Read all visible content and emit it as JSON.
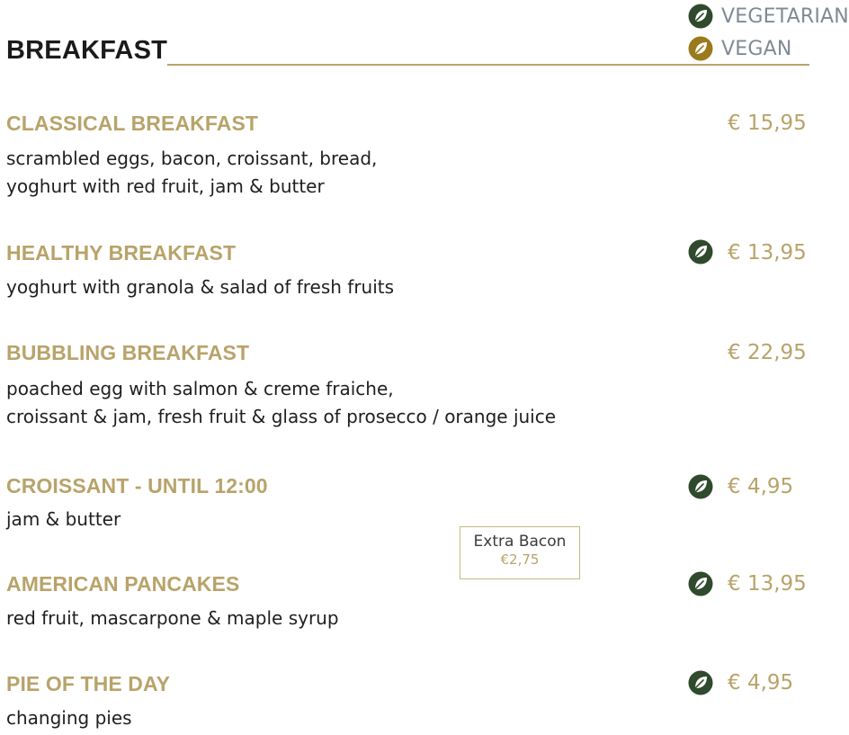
{
  "section_title": "BREAKFAST",
  "legend": [
    {
      "label": "VEGETARIAN",
      "icon": "leaf-vegetarian-icon",
      "color": "#2f4a2c"
    },
    {
      "label": "VEGAN",
      "icon": "leaf-vegan-icon",
      "color": "#9a7a1c"
    }
  ],
  "colors": {
    "accent_gold": "#b8a36a",
    "vegetarian_green": "#2f4a2c",
    "vegan_gold": "#9a7a1c"
  },
  "items": [
    {
      "name": "CLASSICAL BREAKFAST",
      "desc": [
        "scrambled eggs, bacon, croissant, bread,",
        "yoghurt with red fruit, jam & butter"
      ],
      "price": "€ 15,95",
      "badge": ""
    },
    {
      "name": "HEALTHY BREAKFAST",
      "desc": [
        "yoghurt with granola & salad of fresh fruits"
      ],
      "price": "€ 13,95",
      "badge": "vegetarian"
    },
    {
      "name": "BUBBLING BREAKFAST",
      "desc": [
        "poached egg with salmon & creme fraiche,",
        "croissant & jam, fresh fruit & glass of prosecco / orange juice"
      ],
      "price": "€ 22,95",
      "badge": ""
    },
    {
      "name": "CROISSANT - UNTIL 12:00",
      "desc": [
        "jam & butter"
      ],
      "price": "€ 4,95",
      "badge": "vegetarian"
    },
    {
      "name": "AMERICAN PANCAKES",
      "desc": [
        "red fruit, mascarpone & maple syrup"
      ],
      "price": "€ 13,95",
      "badge": "vegetarian"
    },
    {
      "name": "PIE OF THE DAY",
      "desc": [
        "changing pies"
      ],
      "price": "€ 4,95",
      "badge": "vegetarian"
    }
  ],
  "extra": {
    "label": "Extra Bacon",
    "price": "€2,75"
  }
}
